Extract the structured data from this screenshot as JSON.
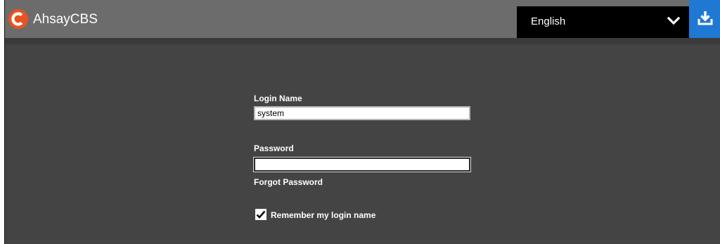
{
  "header": {
    "app_name": "AhsayCBS",
    "language": "English",
    "download_icon": "download-icon",
    "chevron_icon": "chevron-down-icon",
    "brand_color": "#e8531f",
    "download_color": "#1f79d2"
  },
  "login": {
    "login_name_label": "Login Name",
    "login_name_value": "system",
    "password_label": "Password",
    "password_value": "",
    "forgot_password": "Forgot Password",
    "remember_label": "Remember my login name",
    "remember_checked": true
  }
}
